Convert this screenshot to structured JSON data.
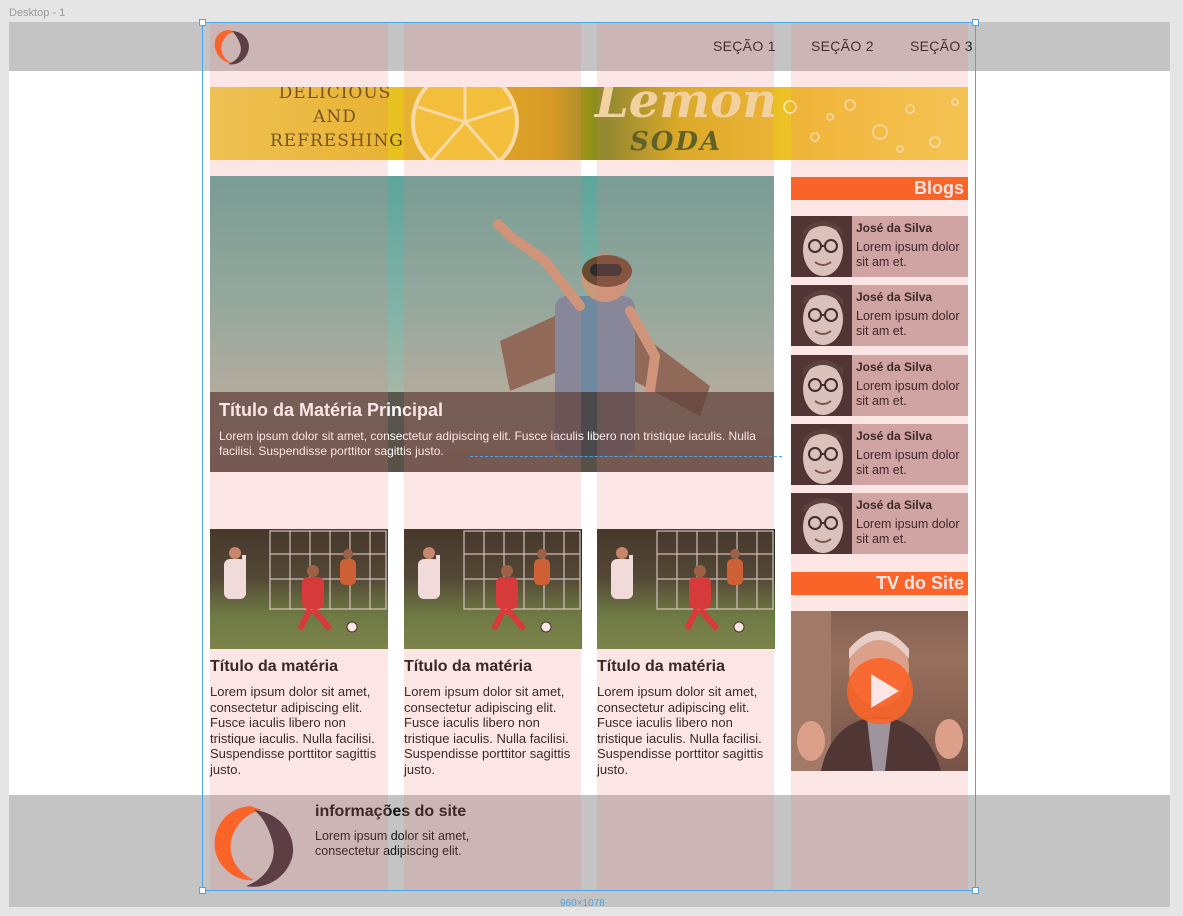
{
  "frame": {
    "label": "Desktop - 1",
    "size_label": "960×1078"
  },
  "header": {
    "nav": [
      "SEÇÃO 1",
      "SEÇÃO 2",
      "SEÇÃO 3"
    ]
  },
  "banner": {
    "tagline": [
      "DELICIOUS",
      "AND",
      "REFRESHING"
    ],
    "brand": "Lemon",
    "brand_sub": "SODA"
  },
  "hero": {
    "title": "Título da Matéria Principal",
    "text": "Lorem ipsum dolor sit amet, consectetur adipiscing elit. Fusce iaculis libero non tristique iaculis. Nulla facilisi. Suspendisse porttitor sagittis justo."
  },
  "cards": [
    {
      "title": "Título da matéria",
      "text": "Lorem ipsum dolor sit amet, consectetur adipiscing elit. Fusce iaculis libero non tristique iaculis. Nulla facilisi. Suspendisse porttitor sagittis justo."
    },
    {
      "title": "Título da matéria",
      "text": "Lorem ipsum dolor sit amet, consectetur adipiscing elit. Fusce iaculis libero non tristique iaculis. Nulla facilisi. Suspendisse porttitor sagittis justo."
    },
    {
      "title": "Título da matéria",
      "text": "Lorem ipsum dolor sit amet, consectetur adipiscing elit. Fusce iaculis libero non tristique iaculis. Nulla facilisi. Suspendisse porttitor sagittis justo."
    }
  ],
  "sidebar": {
    "blogs_title": "Blogs",
    "blogs": [
      {
        "name": "José da Silva",
        "text": "Lorem ipsum dolor sit am et."
      },
      {
        "name": "José da Silva",
        "text": "Lorem ipsum dolor sit am et."
      },
      {
        "name": "José da Silva",
        "text": "Lorem ipsum dolor sit am et."
      },
      {
        "name": "José da Silva",
        "text": "Lorem ipsum dolor sit am et."
      },
      {
        "name": "José da Silva",
        "text": "Lorem ipsum dolor sit am et."
      }
    ],
    "tv_title": "TV do Site",
    "tv_icon": "play-icon"
  },
  "footer": {
    "title": "informações do site",
    "text": "Lorem ipsum dolor sit amet, consectetur adipiscing elit."
  },
  "colors": {
    "accent": "#ff5e13",
    "logo_dark": "#3a2f36",
    "band_gray": "#c4c4c4",
    "selection_blue": "#4aa6e8",
    "grid_overlay": "#ea7e7e"
  }
}
